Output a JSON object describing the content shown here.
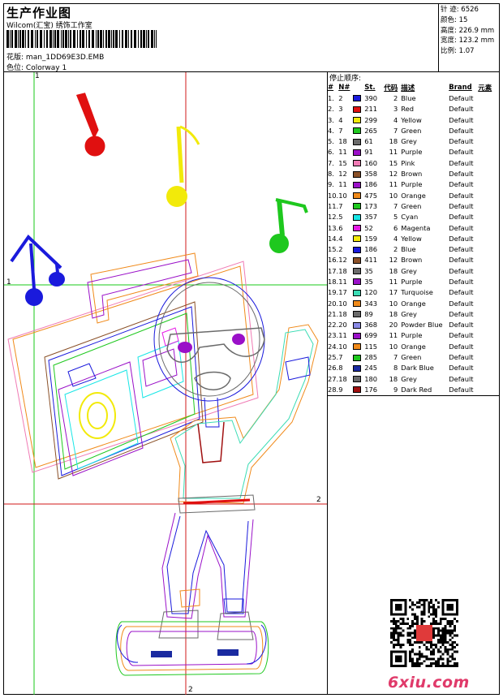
{
  "header": {
    "title": "生产作业图",
    "company": "Wilcom(汇宝) 绣饰工作室",
    "design_label": "花版:",
    "design_name": "man_1DD69E3D.EMB",
    "colorway_label": "色位:",
    "colorway_name": "Colorway 1"
  },
  "stats": [
    {
      "label": "针 迹:",
      "value": "6526"
    },
    {
      "label": "颜色:",
      "value": "15"
    },
    {
      "label": "高度:",
      "value": "226.9 mm"
    },
    {
      "label": "宽度:",
      "value": "123.2 mm"
    },
    {
      "label": "比例:",
      "value": "1.07"
    }
  ],
  "axis_labels": {
    "top": "1",
    "left": "1",
    "right": "2",
    "bottom": "2"
  },
  "sequence": {
    "title": "停止顺序:",
    "headers": {
      "num": "#",
      "n": "N#",
      "st": "St.",
      "code": "代码",
      "desc": "描述",
      "brand": "Brand",
      "extra": "元素"
    },
    "rows": [
      {
        "num": "1.",
        "n": "2",
        "color": "#1a1adc",
        "st": "390",
        "code": "2",
        "desc": "Blue",
        "brand": "Default"
      },
      {
        "num": "2.",
        "n": "3",
        "color": "#e01010",
        "st": "211",
        "code": "3",
        "desc": "Red",
        "brand": "Default"
      },
      {
        "num": "3.",
        "n": "4",
        "color": "#f2ea0a",
        "st": "299",
        "code": "4",
        "desc": "Yellow",
        "brand": "Default"
      },
      {
        "num": "4.",
        "n": "7",
        "color": "#1ec81e",
        "st": "265",
        "code": "7",
        "desc": "Green",
        "brand": "Default"
      },
      {
        "num": "5.",
        "n": "18",
        "color": "#6a6a6a",
        "st": "61",
        "code": "18",
        "desc": "Grey",
        "brand": "Default"
      },
      {
        "num": "6.",
        "n": "11",
        "color": "#9a10c8",
        "st": "91",
        "code": "11",
        "desc": "Purple",
        "brand": "Default"
      },
      {
        "num": "7.",
        "n": "15",
        "color": "#f07ab4",
        "st": "160",
        "code": "15",
        "desc": "Pink",
        "brand": "Default"
      },
      {
        "num": "8.",
        "n": "12",
        "color": "#8a5028",
        "st": "358",
        "code": "12",
        "desc": "Brown",
        "brand": "Default"
      },
      {
        "num": "9.",
        "n": "11",
        "color": "#9a10c8",
        "st": "186",
        "code": "11",
        "desc": "Purple",
        "brand": "Default"
      },
      {
        "num": "10.",
        "n": "10",
        "color": "#f08a1a",
        "st": "475",
        "code": "10",
        "desc": "Orange",
        "brand": "Default"
      },
      {
        "num": "11.",
        "n": "7",
        "color": "#1ec81e",
        "st": "173",
        "code": "7",
        "desc": "Green",
        "brand": "Default"
      },
      {
        "num": "12.",
        "n": "5",
        "color": "#18e6e6",
        "st": "357",
        "code": "5",
        "desc": "Cyan",
        "brand": "Default"
      },
      {
        "num": "13.",
        "n": "6",
        "color": "#e61ae6",
        "st": "52",
        "code": "6",
        "desc": "Magenta",
        "brand": "Default"
      },
      {
        "num": "14.",
        "n": "4",
        "color": "#f2ea0a",
        "st": "159",
        "code": "4",
        "desc": "Yellow",
        "brand": "Default"
      },
      {
        "num": "15.",
        "n": "2",
        "color": "#1a1adc",
        "st": "186",
        "code": "2",
        "desc": "Blue",
        "brand": "Default"
      },
      {
        "num": "16.",
        "n": "12",
        "color": "#8a5028",
        "st": "411",
        "code": "12",
        "desc": "Brown",
        "brand": "Default"
      },
      {
        "num": "17.",
        "n": "18",
        "color": "#6a6a6a",
        "st": "35",
        "code": "18",
        "desc": "Grey",
        "brand": "Default"
      },
      {
        "num": "18.",
        "n": "11",
        "color": "#9a10c8",
        "st": "35",
        "code": "11",
        "desc": "Purple",
        "brand": "Default"
      },
      {
        "num": "19.",
        "n": "17",
        "color": "#3adcb4",
        "st": "120",
        "code": "17",
        "desc": "Turquoise",
        "brand": "Default"
      },
      {
        "num": "20.",
        "n": "10",
        "color": "#f08a1a",
        "st": "343",
        "code": "10",
        "desc": "Orange",
        "brand": "Default"
      },
      {
        "num": "21.",
        "n": "18",
        "color": "#6a6a6a",
        "st": "89",
        "code": "18",
        "desc": "Grey",
        "brand": "Default"
      },
      {
        "num": "22.",
        "n": "20",
        "color": "#8a8ae6",
        "st": "368",
        "code": "20",
        "desc": "Powder Blue",
        "brand": "Default"
      },
      {
        "num": "23.",
        "n": "11",
        "color": "#9a10c8",
        "st": "699",
        "code": "11",
        "desc": "Purple",
        "brand": "Default"
      },
      {
        "num": "24.",
        "n": "10",
        "color": "#f08a1a",
        "st": "115",
        "code": "10",
        "desc": "Orange",
        "brand": "Default"
      },
      {
        "num": "25.",
        "n": "7",
        "color": "#1ec81e",
        "st": "285",
        "code": "7",
        "desc": "Green",
        "brand": "Default"
      },
      {
        "num": "26.",
        "n": "8",
        "color": "#1a2aa0",
        "st": "245",
        "code": "8",
        "desc": "Dark Blue",
        "brand": "Default"
      },
      {
        "num": "27.",
        "n": "18",
        "color": "#6a6a6a",
        "st": "180",
        "code": "18",
        "desc": "Grey",
        "brand": "Default"
      },
      {
        "num": "28.",
        "n": "9",
        "color": "#a01010",
        "st": "176",
        "code": "9",
        "desc": "Dark Red",
        "brand": "Default"
      }
    ]
  },
  "watermark": "6xiu.com",
  "colors": {
    "guide_green": "#19c819",
    "guide_red": "#d01818"
  }
}
